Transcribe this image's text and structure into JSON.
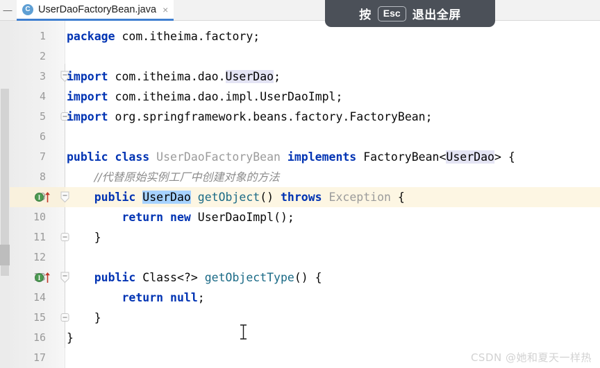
{
  "window": {
    "minimize_glyph": "—"
  },
  "tab": {
    "icon_label": "C",
    "filename": "UserDaoFactoryBean.java",
    "close_glyph": "×"
  },
  "fullscreen_hint": {
    "prefix": "按",
    "key": "Esc",
    "suffix": "退出全屏"
  },
  "editor": {
    "caret_line": 9,
    "lines": [
      {
        "n": "1",
        "text": "package com.itheima.factory;"
      },
      {
        "n": "2",
        "text": ""
      },
      {
        "n": "3",
        "text": "import com.itheima.dao.UserDao;"
      },
      {
        "n": "4",
        "text": "import com.itheima.dao.impl.UserDaoImpl;"
      },
      {
        "n": "5",
        "text": "import org.springframework.beans.factory.FactoryBean;"
      },
      {
        "n": "6",
        "text": ""
      },
      {
        "n": "7",
        "text": "public class UserDaoFactoryBean implements FactoryBean<UserDao> {"
      },
      {
        "n": "8",
        "text": "    //代替原始实例工厂中创建对象的方法"
      },
      {
        "n": "9",
        "text": "    public UserDao getObject() throws Exception {"
      },
      {
        "n": "10",
        "text": "        return new UserDaoImpl();"
      },
      {
        "n": "11",
        "text": "    }"
      },
      {
        "n": "12",
        "text": ""
      },
      {
        "n": "13",
        "text": "    public Class<?> getObjectType() {"
      },
      {
        "n": "14",
        "text": "        return null;"
      },
      {
        "n": "15",
        "text": "    }"
      },
      {
        "n": "16",
        "text": "}"
      },
      {
        "n": "17",
        "text": ""
      }
    ],
    "gutter_icons": [
      {
        "line": 9,
        "name": "implementing-method-marker"
      },
      {
        "line": 13,
        "name": "implementing-method-marker"
      }
    ],
    "fold_markers": [
      3,
      5,
      9,
      11,
      13,
      15
    ]
  },
  "colors": {
    "keyword": "#0033b3",
    "type": "#9b9b9b",
    "method": "#1a6a86",
    "comment": "#8c8c8c",
    "selection": "#a6d2ff",
    "caret_line": "#fdf6e3",
    "tab_underline": "#3f7fd0",
    "hint_background": "#4b5058"
  },
  "watermark": {
    "text": "CSDN @她和夏天一样热"
  }
}
